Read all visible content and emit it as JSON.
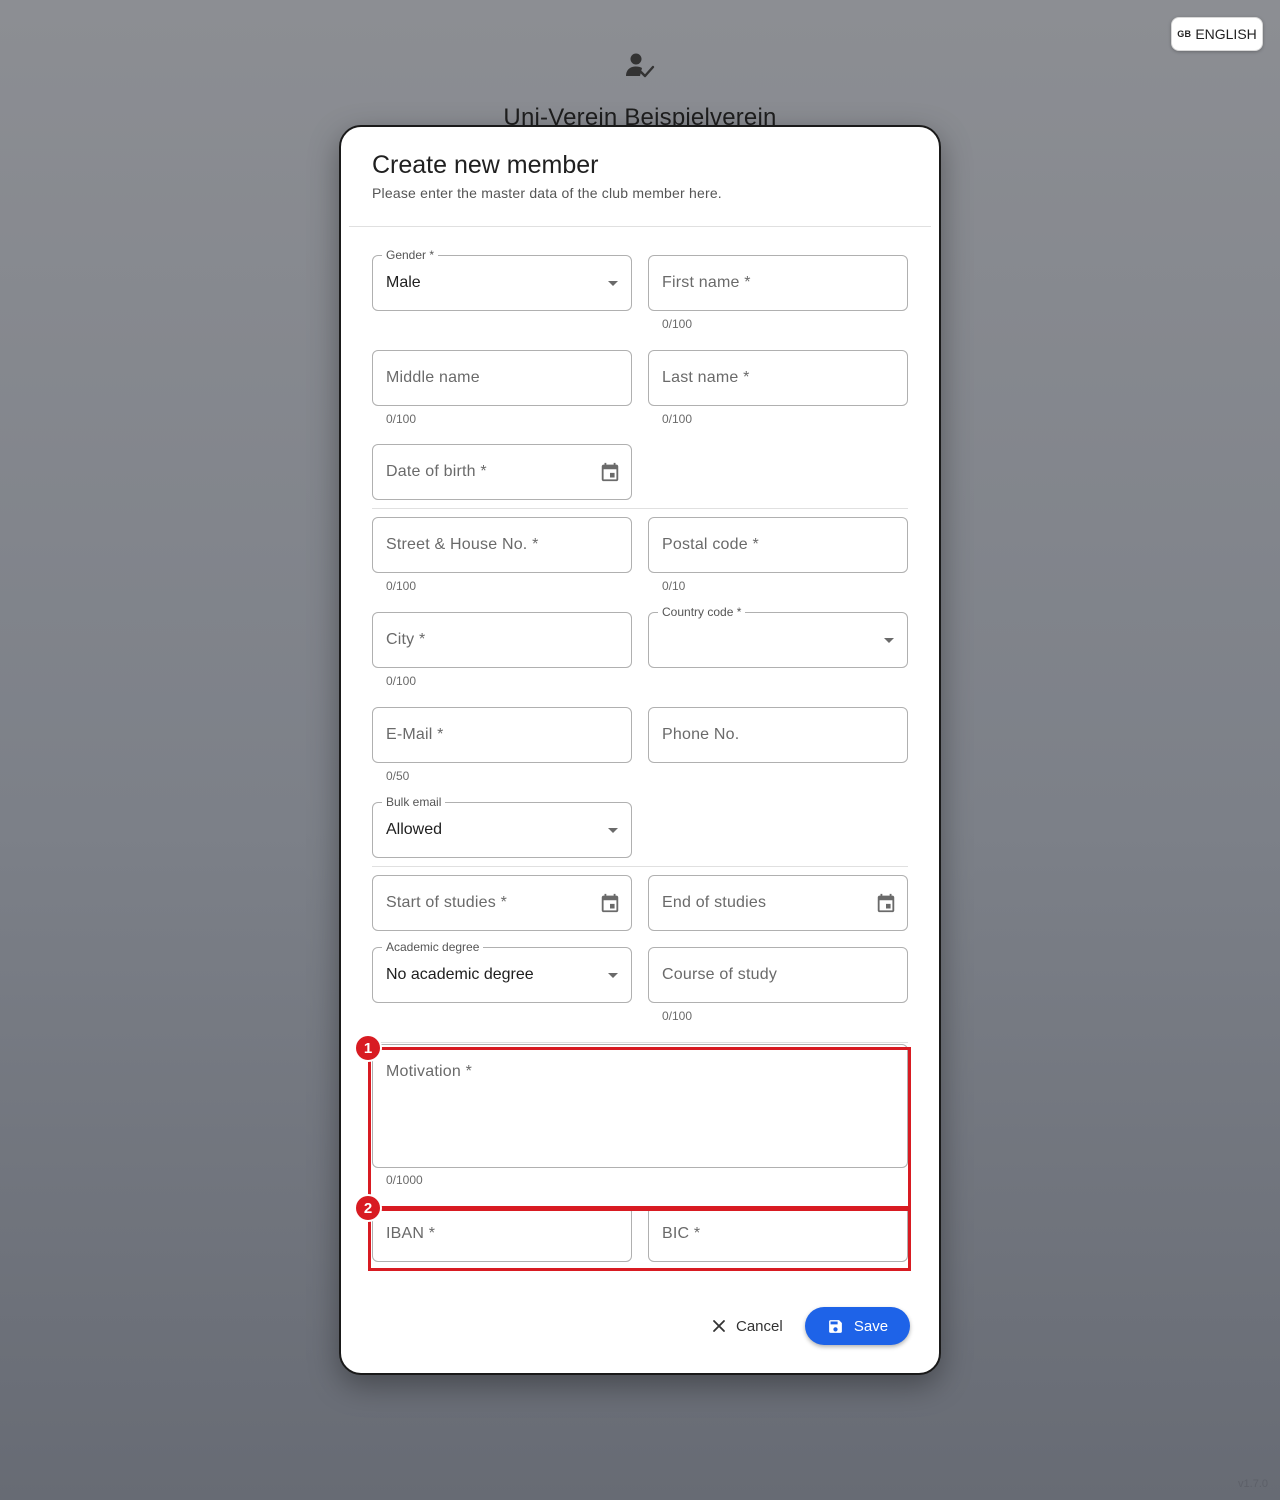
{
  "language": {
    "flag": "GB",
    "label": "ENGLISH"
  },
  "background": {
    "title": "Uni-Verein Beispielverein",
    "version": "v1.7.0"
  },
  "dialog": {
    "title": "Create new member",
    "subtitle": "Please enter the master data of the club member here.",
    "fields": {
      "gender": {
        "label": "Gender *",
        "value": "Male"
      },
      "first_name": {
        "placeholder": "First name *",
        "counter": "0/100"
      },
      "middle_name": {
        "placeholder": "Middle name",
        "counter": "0/100"
      },
      "last_name": {
        "placeholder": "Last name *",
        "counter": "0/100"
      },
      "date_of_birth": {
        "placeholder": "Date of birth *"
      },
      "street": {
        "placeholder": "Street & House No. *",
        "counter": "0/100"
      },
      "postal_code": {
        "placeholder": "Postal code *",
        "counter": "0/10"
      },
      "city": {
        "placeholder": "City *",
        "counter": "0/100"
      },
      "country_code": {
        "label": "Country code *",
        "value": ""
      },
      "email": {
        "placeholder": "E-Mail *",
        "counter": "0/50"
      },
      "phone": {
        "placeholder": "Phone No."
      },
      "bulk_email": {
        "label": "Bulk email",
        "value": "Allowed"
      },
      "start_of_studies": {
        "placeholder": "Start of studies *"
      },
      "end_of_studies": {
        "placeholder": "End of studies"
      },
      "academic_degree": {
        "label": "Academic degree",
        "value": "No academic degree"
      },
      "course_of_study": {
        "placeholder": "Course of study",
        "counter": "0/100"
      },
      "motivation": {
        "placeholder": "Motivation *",
        "counter": "0/1000"
      },
      "iban": {
        "placeholder": "IBAN *"
      },
      "bic": {
        "placeholder": "BIC *"
      }
    },
    "highlights": [
      "1",
      "2"
    ],
    "actions": {
      "cancel": "Cancel",
      "save": "Save"
    }
  },
  "colors": {
    "primary": "#1e63e8",
    "highlight": "#d81b22"
  }
}
